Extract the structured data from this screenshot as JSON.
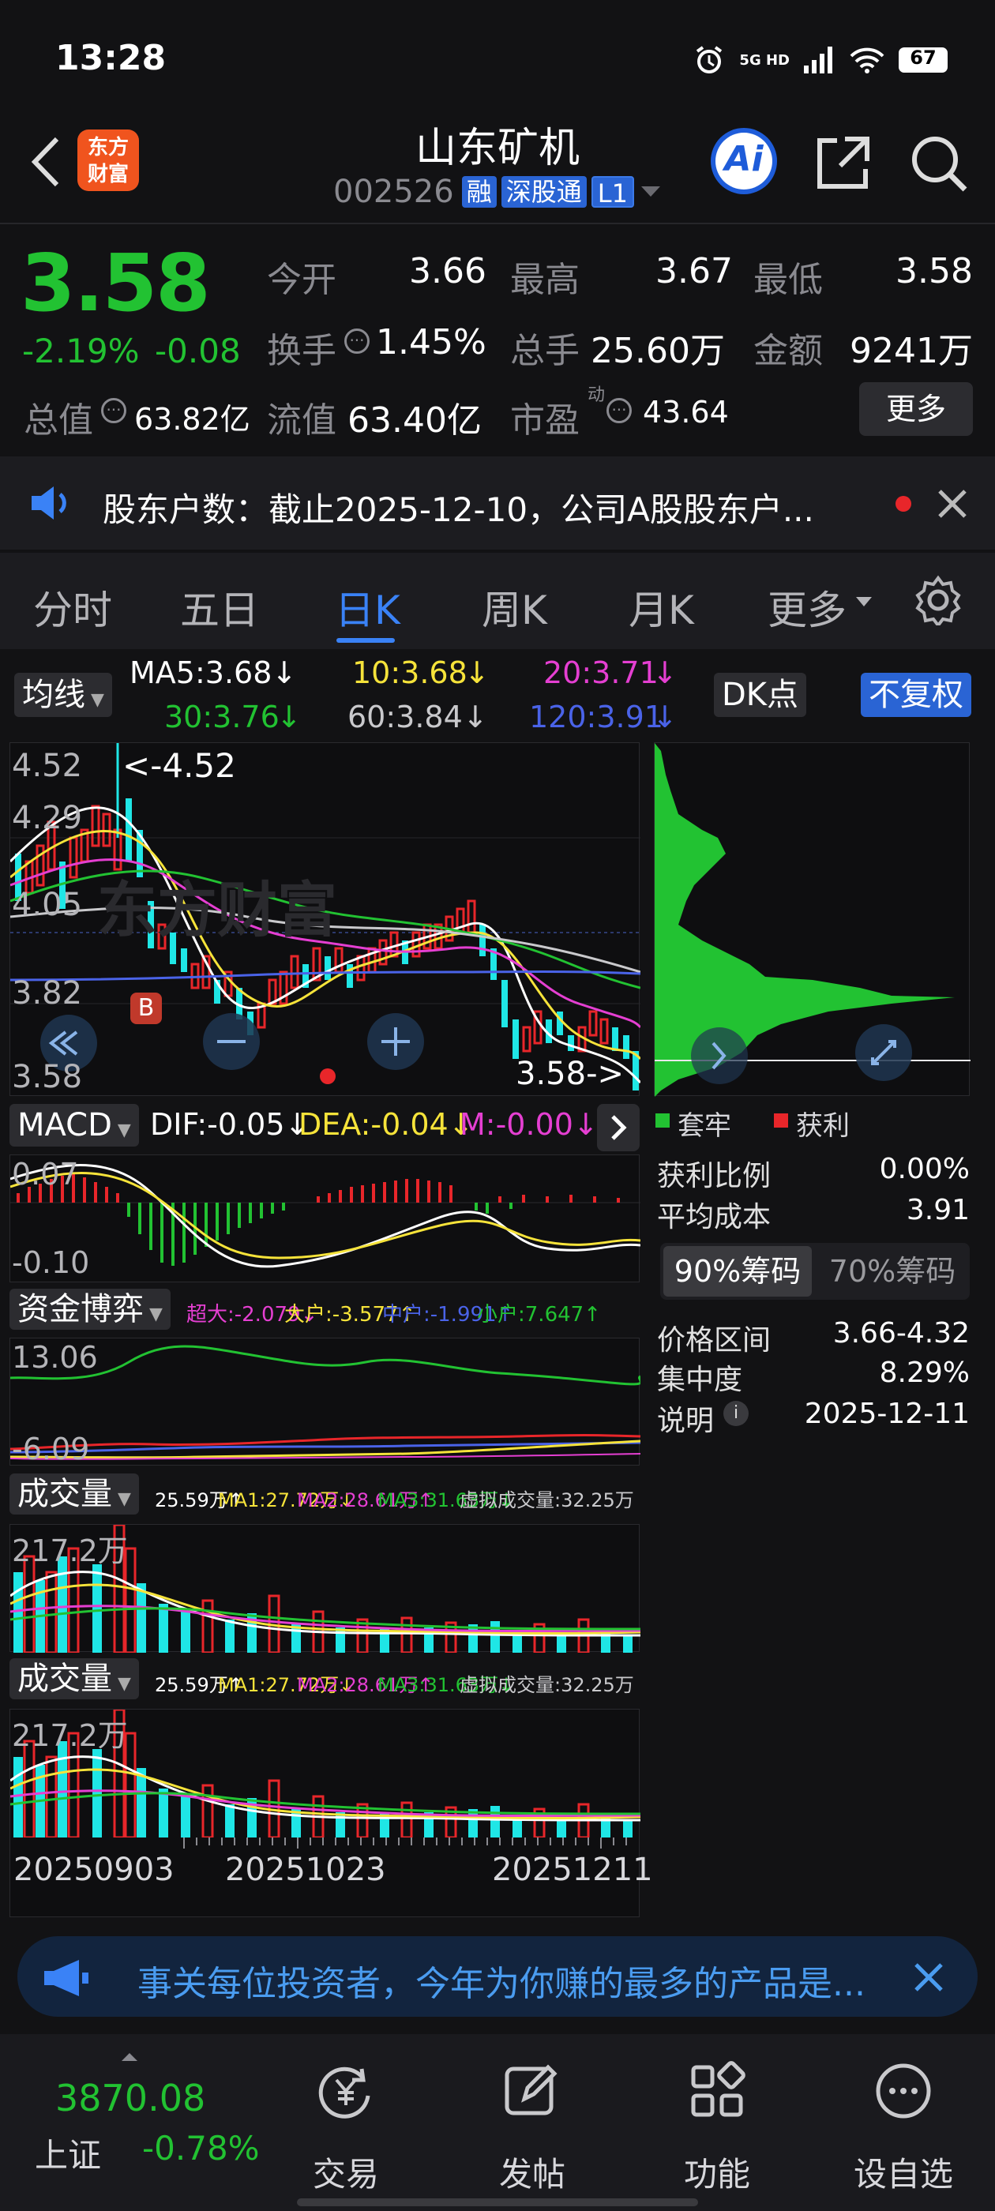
{
  "status": {
    "time": "13:28",
    "network": "5G HD",
    "battery": "67"
  },
  "header": {
    "name": "山东矿机",
    "code": "002526",
    "tags": [
      "融",
      "深股通",
      "L1"
    ],
    "logo": [
      "东方",
      "财富"
    ],
    "ai_label": "Ai"
  },
  "quote": {
    "price": "3.58",
    "pct": "-2.19%",
    "change": "-0.08",
    "open_label": "今开",
    "open": "3.66",
    "high_label": "最高",
    "high": "3.67",
    "low_label": "最低",
    "low": "3.58",
    "turnover_label": "换手",
    "turnover": "1.45%",
    "volume_label": "总手",
    "volume": "25.60万",
    "amount_label": "金额",
    "amount": "9241万",
    "mktcap_label": "总值",
    "mktcap": "63.82亿",
    "float_label": "流值",
    "float": "63.40亿",
    "pe_label": "市盈",
    "pe_sup": "动",
    "pe": "43.64",
    "more": "更多"
  },
  "notice": {
    "text": "股东户数：截止2025-12-10，公司A股股东户..."
  },
  "tabs": [
    "分时",
    "五日",
    "日K",
    "周K",
    "月K",
    "更多"
  ],
  "ma_bar": {
    "mode": "均线",
    "ma5": "MA5:3.68",
    "ma10": "10:3.68",
    "ma20": "20:3.71",
    "ma30": "30:3.76",
    "ma60": "60:3.84",
    "ma120": "120:3.91",
    "arrow": "↓",
    "dk": "DK点",
    "fq": "不复权"
  },
  "kchart": {
    "y_labels": [
      "4.52",
      "4.29",
      "4.05",
      "3.82",
      "3.58"
    ],
    "max_label": "<-4.52",
    "last_label": "3.58->",
    "b_marker": "B",
    "watermark": "东方财富"
  },
  "macd": {
    "name": "MACD",
    "dif": "DIF:-0.05↓",
    "dea": "DEA:-0.04↓",
    "m": "M:-0.00↓",
    "y_top": "0.07",
    "y_bottom": "-0.10"
  },
  "fund": {
    "name": "资金博弈",
    "super": "超大:-2.079↓",
    "big": "大户:-3.577↑",
    "mid": "中户:-1.991↑",
    "small": "小户:7.647↑",
    "y_top": "13.06",
    "y_bottom": "-6.09"
  },
  "volume1": {
    "name": "成交量",
    "v": "25.59万↑",
    "ma1": "MA1:27.72万↓",
    "ma2": "MA2:28.61万↑",
    "ma3": "MA3:31.63万↓",
    "virtual": "虚拟成交量:32.25万",
    "y_top": "217.2万"
  },
  "volume2": {
    "name": "成交量",
    "v": "25.59万↑",
    "ma1": "MA1:27.72万↓",
    "ma2": "MA2:28.61万↑",
    "ma3": "MA3:31.63万↓",
    "virtual": "虚拟成交量:32.25万",
    "y_top": "217.2万"
  },
  "x_dates": [
    "20250903",
    "20251023",
    "20251211"
  ],
  "chips": {
    "legend_trap": "套牢",
    "legend_profit": "获利",
    "profit_ratio_label": "获利比例",
    "profit_ratio": "0.00%",
    "avg_cost_label": "平均成本",
    "avg_cost": "3.91",
    "tab90": "90%筹码",
    "tab70": "70%筹码",
    "range_label": "价格区间",
    "range": "3.66-4.32",
    "conc_label": "集中度",
    "conc": "8.29%",
    "desc_label": "说明",
    "desc": "2025-12-11"
  },
  "banner": {
    "text": "事关每位投资者，今年为你赚的最多的产品是..."
  },
  "nav": {
    "index_value": "3870.08",
    "index_name": "上证",
    "index_pct": "-0.78%",
    "items": [
      "交易",
      "发帖",
      "功能",
      "设自选"
    ]
  }
}
